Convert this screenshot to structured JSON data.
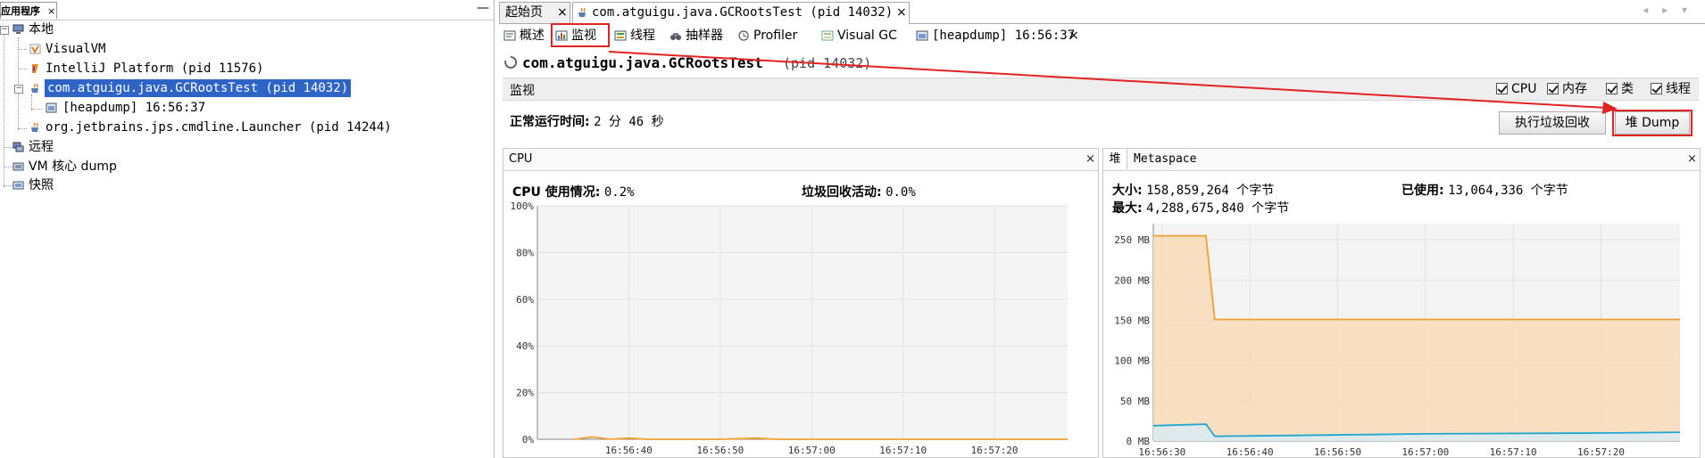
{
  "left_panel": {
    "tab_label": "应用程序",
    "tab_close": "×",
    "minimize": "—",
    "tree": {
      "local": "本地",
      "visualvm": "VisualVM",
      "intellij": "IntelliJ Platform (pid 11576)",
      "gcroots": "com.atguigu.java.GCRootsTest (pid 14032)",
      "heapdump": "[heapdump] 16:56:37",
      "launcher": "org.jetbrains.jps.cmdline.Launcher (pid 14244)",
      "remote": "远程",
      "core_dump": "VM 核心 dump",
      "snapshot": "快照"
    }
  },
  "doc_tabs": {
    "start_page": "起始页",
    "process_tab": "com.atguigu.java.GCRootsTest (pid 14032)",
    "close": "×",
    "nav_arrows": "◂ ▸ ▾"
  },
  "sub_tabs": {
    "overview": "概述",
    "monitor": "监视",
    "threads": "线程",
    "sampler": "抽样器",
    "profiler": "Profiler",
    "visual_gc": "Visual GC",
    "heapdump": "[heapdump] 16:56:37",
    "close": "×"
  },
  "main": {
    "app_name": "com.atguigu.java.GCRootsTest",
    "app_pid": "(pid 14032)",
    "monitor_label": "监视",
    "checkboxes": {
      "cpu": "CPU",
      "memory": "内存",
      "classes": "类",
      "threads": "线程"
    },
    "uptime_label": "正常运行时间:",
    "uptime_value": "2 分 46 秒",
    "gc_button": "执行垃圾回收",
    "heap_dump_button": "堆 Dump"
  },
  "cpu_panel": {
    "title": "CPU",
    "close": "×",
    "usage_label": "CPU 使用情况:",
    "usage_value": "0.2%",
    "gc_activity_label": "垃圾回收活动:",
    "gc_activity_value": "0.0%"
  },
  "heap_panel": {
    "tab_heap": "堆",
    "tab_metaspace": "Metaspace",
    "close": "×",
    "size_label": "大小:",
    "size_value": "158,859,264 个字节",
    "used_label": "已使用:",
    "used_value": "13,064,336 个字节",
    "max_label": "最大:",
    "max_value": "4,288,675,840 个字节"
  },
  "colors": {
    "selection": "#2f64c7",
    "annotation_red": "#e32222",
    "heap_size_line": "#f0a030",
    "heap_size_fill": "#fbd8b0",
    "heap_used_line": "#1ea6d0",
    "heap_used_fill": "#d4eef8",
    "cpu_line": "#f0a030"
  },
  "chart_data": [
    {
      "type": "line",
      "name": "cpu",
      "x": [
        "16:56:34",
        "16:56:36",
        "16:56:38",
        "16:56:40",
        "16:56:42",
        "16:56:44",
        "16:56:50",
        "16:56:54",
        "16:56:56",
        "16:57:00",
        "16:57:10",
        "16:57:20",
        "16:57:28"
      ],
      "series": [
        {
          "values": [
            0,
            1.0,
            0,
            0.5,
            0,
            0,
            0,
            0.5,
            0,
            0,
            0,
            0,
            0
          ]
        }
      ],
      "y_ticks": [
        "0%",
        "20%",
        "40%",
        "60%",
        "80%",
        "100%"
      ],
      "x_ticks": [
        "16:56:40",
        "16:56:50",
        "16:57:00",
        "16:57:10",
        "16:57:20"
      ],
      "ylim": [
        0,
        100
      ]
    },
    {
      "type": "area",
      "name": "heap",
      "x": [
        "16:56:29",
        "16:56:35",
        "16:56:36",
        "16:56:45",
        "16:57:00",
        "16:57:20",
        "16:57:29"
      ],
      "series": [
        {
          "role": "size",
          "values": [
            255,
            255,
            151,
            151,
            151,
            151,
            151
          ]
        },
        {
          "role": "used",
          "values": [
            19,
            21,
            6,
            7,
            9,
            10,
            11
          ]
        }
      ],
      "y_ticks": [
        "0 MB",
        "50 MB",
        "100 MB",
        "150 MB",
        "200 MB",
        "250 MB"
      ],
      "x_ticks": [
        "16:56:30",
        "16:56:40",
        "16:56:50",
        "16:57:00",
        "16:57:10",
        "16:57:20"
      ],
      "ylim": [
        0,
        270
      ]
    }
  ]
}
